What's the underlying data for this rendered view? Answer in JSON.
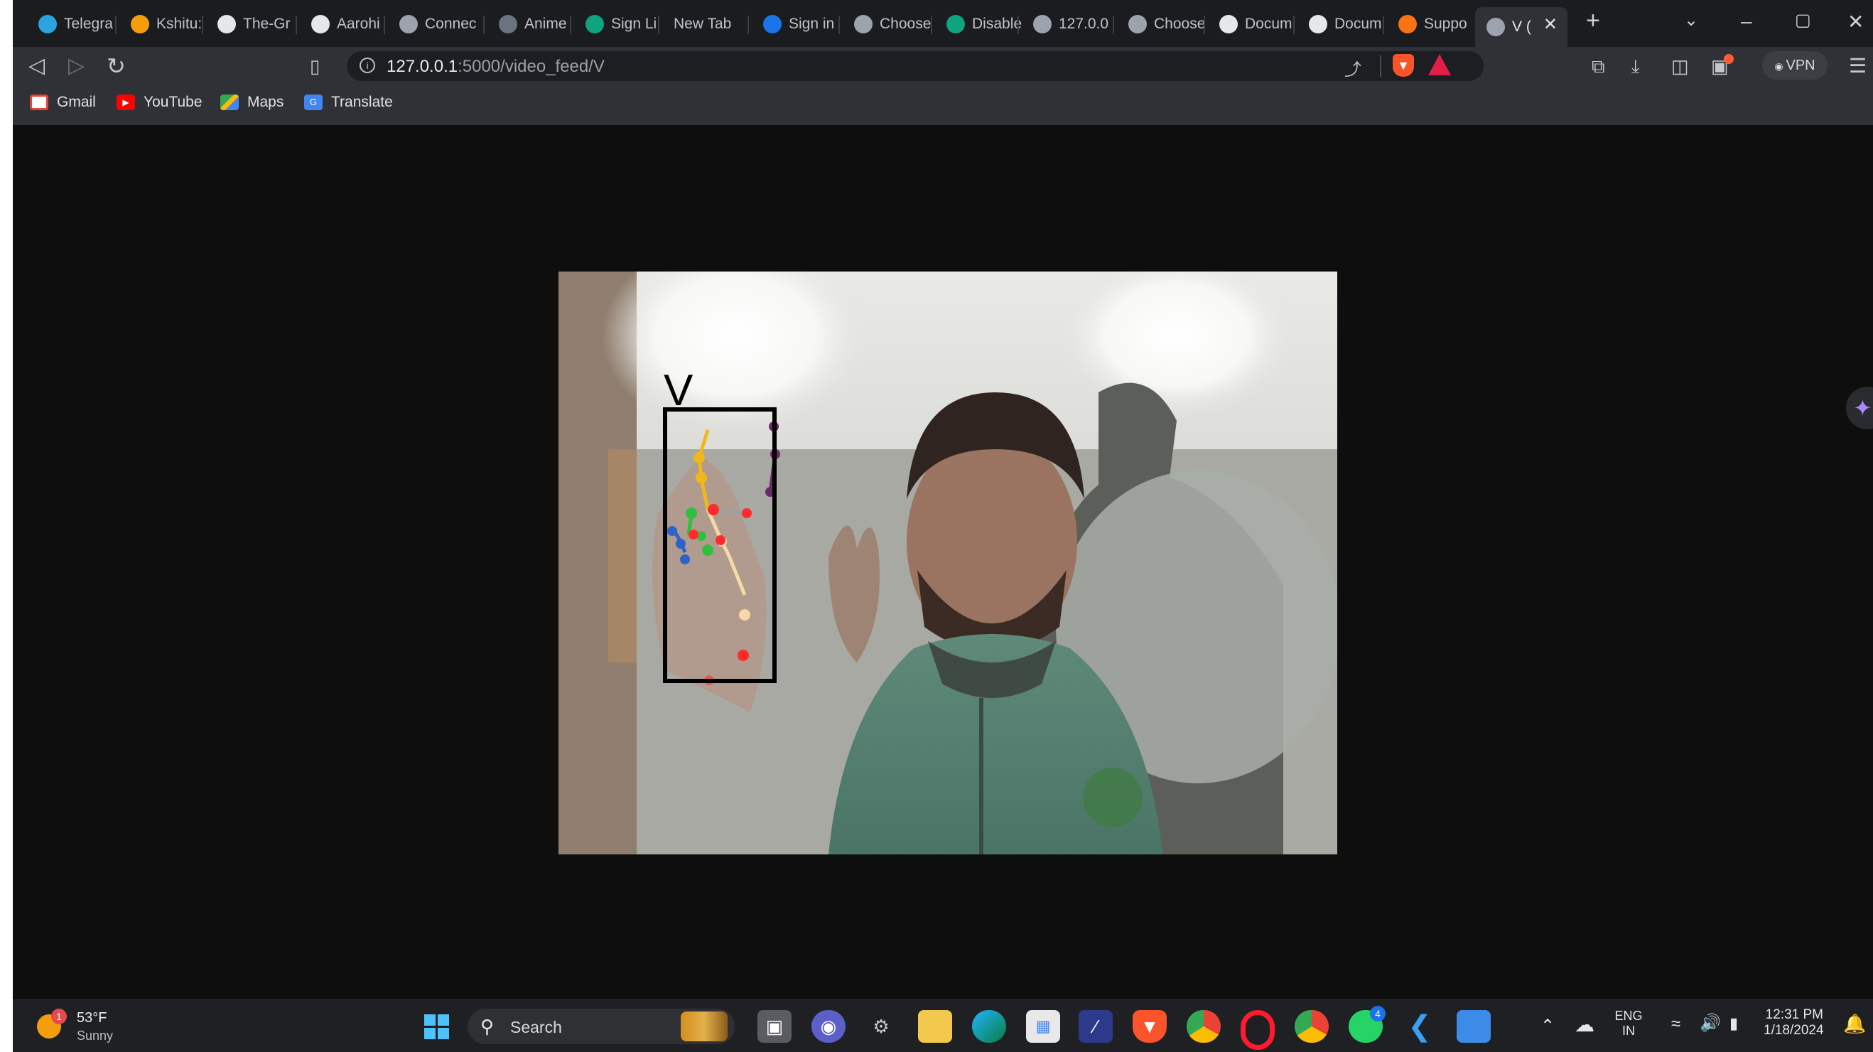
{
  "browser": {
    "tabs": [
      {
        "label": "Telegra",
        "icon": "telegram-icon",
        "color": "#2aa3df"
      },
      {
        "label": "Kshitu:",
        "icon": "infinity-icon",
        "color": "#f59e0b"
      },
      {
        "label": "The-Gr",
        "icon": "github-icon",
        "color": "#e5e7eb"
      },
      {
        "label": "Aarohi",
        "icon": "github-icon",
        "color": "#e5e7eb"
      },
      {
        "label": "Connec",
        "icon": "logo-icon",
        "color": "#9ca3af"
      },
      {
        "label": "Anime",
        "icon": "play-icon",
        "color": "#6b7280"
      },
      {
        "label": "Sign Li",
        "icon": "openai-icon",
        "color": "#10a37f"
      },
      {
        "label": "New Tab",
        "icon": "",
        "color": ""
      },
      {
        "label": "Sign in",
        "icon": "s-icon",
        "color": "#1a73e8"
      },
      {
        "label": "Choose",
        "icon": "globe-icon",
        "color": "#9ca3af"
      },
      {
        "label": "Disable",
        "icon": "openai-icon",
        "color": "#10a37f"
      },
      {
        "label": "127.0.0",
        "icon": "globe-icon",
        "color": "#9ca3af"
      },
      {
        "label": "Choose",
        "icon": "globe-icon",
        "color": "#9ca3af"
      },
      {
        "label": "Docum",
        "icon": "doc-icon",
        "color": "#e5e7eb"
      },
      {
        "label": "Docum",
        "icon": "doc-icon",
        "color": "#e5e7eb"
      },
      {
        "label": "Suppo",
        "icon": "support-icon",
        "color": "#f97316"
      },
      {
        "label": "V (",
        "icon": "globe-icon",
        "color": "#9ca3af",
        "active": true
      }
    ],
    "url_host": "127.0.0.1",
    "url_path": ":5000/video_feed/V",
    "vpn_label": "VPN",
    "bookmarks": [
      {
        "label": "Gmail",
        "icon": "gmail-icon",
        "color": "#ea4335"
      },
      {
        "label": "YouTube",
        "icon": "youtube-icon",
        "color": "#ff0000"
      },
      {
        "label": "Maps",
        "icon": "maps-icon",
        "color": "#34a853"
      },
      {
        "label": "Translate",
        "icon": "translate-icon",
        "color": "#4285f4"
      }
    ]
  },
  "video": {
    "prediction_label": "V"
  },
  "taskbar": {
    "weather_temp": "53°F",
    "weather_desc": "Sunny",
    "weather_badge": "1",
    "search_placeholder": "Search",
    "lang_top": "ENG",
    "lang_bottom": "IN",
    "time": "12:31 PM",
    "date": "1/18/2024",
    "whatsapp_badge": "4"
  }
}
